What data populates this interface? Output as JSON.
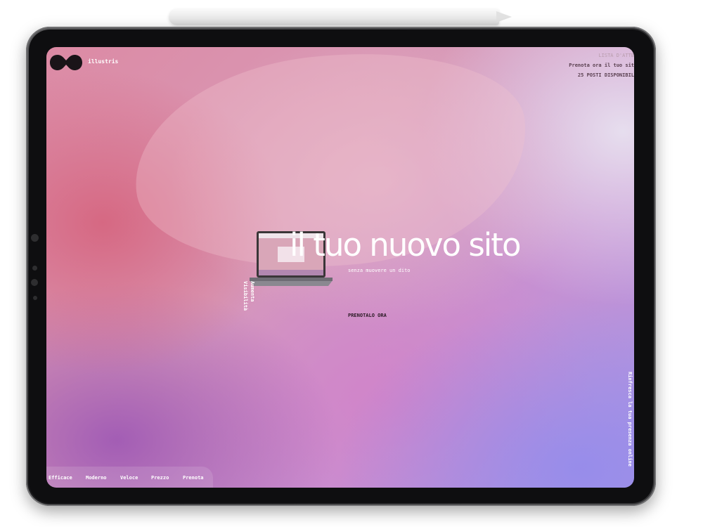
{
  "brand": {
    "name": "illustris",
    "logo_icon": "infinity-blob-icon"
  },
  "top_right": {
    "line1": "LISTA D'ATTE",
    "line2": "Prenota ora il tuo sit",
    "line3": "25 POSTI DISPONIBIL"
  },
  "hero": {
    "headline": "il tuo nuovo sito",
    "subline": "senza muovere un dito",
    "cta": "PRENOTALO ORA",
    "side_label": "Aumenta\nVisibilità"
  },
  "side_right_label": "Rinfresca la tua presenza online",
  "nav": {
    "items": [
      {
        "label": "Efficace"
      },
      {
        "label": "Moderno"
      },
      {
        "label": "Veloce"
      },
      {
        "label": "Prezzo"
      },
      {
        "label": "Prenota"
      }
    ]
  },
  "colors": {
    "headline": "#ffffff",
    "cta_text": "#2a1a24",
    "device_frame": "#1b1b1d"
  }
}
